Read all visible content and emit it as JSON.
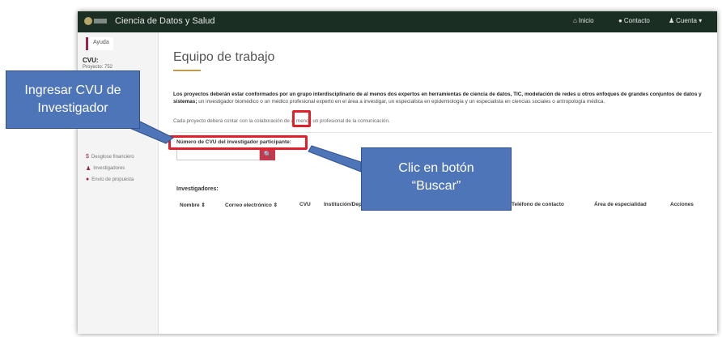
{
  "header": {
    "app_title": "Ciencia de Datos y Salud",
    "nav": [
      {
        "label": "Inicio",
        "icon": "home-icon"
      },
      {
        "label": "Contacto",
        "icon": "chat-icon"
      },
      {
        "label": "Cuenta ▾",
        "icon": "user-icon"
      }
    ]
  },
  "sidebar": {
    "ayuda": "Ayuda",
    "cvu_label": "CVU:",
    "project_label": "Proyecto: 752",
    "items": [
      {
        "label": "Desglose financiero",
        "icon": "$"
      },
      {
        "label": "Investigadores",
        "icon": "user-group-icon"
      },
      {
        "label": "Envío de propuesta",
        "icon": "circle-icon"
      }
    ]
  },
  "main": {
    "title": "Equipo de trabajo",
    "intro_bold": "Los proyectos deberán estar conformados por un grupo interdisciplinario de al menos dos expertos en herramientas de ciencia de datos, TIC, modelación de redes u otros enfoques de grandes conjuntos de datos y sistemas;",
    "intro_rest": " un investigador biomédico o un médico profesional experto en el área a investigar, un especialista en epidemiología y un especialista en ciencias sociales o antropología médica.",
    "note": "Cada proyecto deberá contar con la colaboración de al menos un profesional de la comunicación.",
    "search_label": "Número de CVU del investigador participante:",
    "search_value": "",
    "search_button": "🔍",
    "investigators_label": "Investigadores:",
    "columns": [
      "Nombre ⇕",
      "Correo electrónico ⇕",
      "CVU",
      "Institución/Dependencia",
      "Teléfono de contacto",
      "Área de especialidad",
      "Acciones"
    ]
  },
  "annotations": {
    "callout_left": [
      "Ingresar CVU de",
      "Investigador"
    ],
    "callout_right": [
      "Clic en botón",
      "“Buscar”"
    ],
    "highlight_color": "#e0202a",
    "callout_color": "#4e75b8"
  }
}
